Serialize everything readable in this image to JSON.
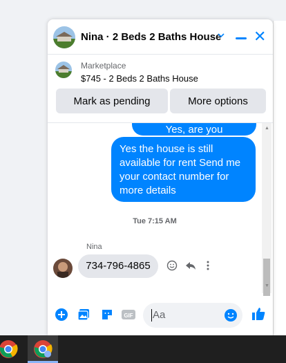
{
  "chat": {
    "title": "Nina · 2 Beds 2 Baths House",
    "colors": {
      "accent": "#0084ff",
      "bubble_in": "#e4e6eb",
      "muted": "#65676b"
    },
    "icons": {
      "minimize": "minimize-icon",
      "close": "close-icon",
      "chevron": "chevron-down-icon"
    }
  },
  "marketplace": {
    "label": "Marketplace",
    "item": "$745 - 2 Beds 2 Baths House",
    "mark_pending": "Mark as pending",
    "more_options": "More options"
  },
  "messages": {
    "out_partial": "Yes, are you interested?",
    "out_main": "Yes the house is still available for rent Send me your contact number for more details",
    "timestamp": "Tue 7:15 AM",
    "sender": "Nina",
    "in_text": "734-796-4865"
  },
  "composer": {
    "placeholder": "Aa",
    "gif_label": "GIF"
  }
}
